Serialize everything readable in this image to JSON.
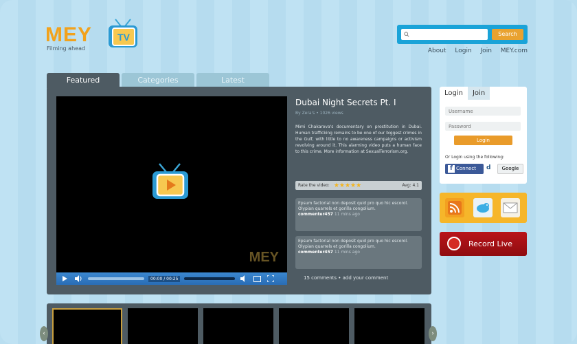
{
  "brand": {
    "name": "MEY",
    "tv": "TV",
    "tagline": "Filming ahead",
    "watermark": "MEY"
  },
  "search": {
    "placeholder": "",
    "button": "Search"
  },
  "top_links": [
    "About",
    "Login",
    "Join",
    "MEY.com"
  ],
  "tabs": [
    {
      "label": "Featured",
      "active": true
    },
    {
      "label": "Categories",
      "active": false
    },
    {
      "label": "Latest",
      "active": false
    }
  ],
  "player": {
    "time": "00:00 / 00:25"
  },
  "video": {
    "title": "Dubai Night Secrets Pt. I",
    "meta": "By Zera's • 1026 views",
    "description": "Mimi Chakarova's documentary on prostitution in Dubai. Human trafficking remains to be one of our biggest crimes in the Gulf, with little to no awareness campaigns or activism revolving around it. This alarming video puts a human face to this crime. More information at SexualTerrorism.org.",
    "rate_label": "Rate the video:",
    "rating_stars": 5,
    "avg_label": "Avg: 4.1"
  },
  "comments": [
    {
      "text": "Epsum factorial non deposit quid pro quo hic escorol. Olypian quarrels et gorilla congolium.",
      "user": "commenter457",
      "time": "11 mins ago"
    },
    {
      "text": "Epsum factorial non deposit quid pro quo hic escorol. Olypian quarrels et gorilla congolium.",
      "user": "commenter457",
      "time": "11 mins ago"
    }
  ],
  "comments_link": "15 comments  •  add your comment",
  "login": {
    "tab_login": "Login",
    "tab_join": "Join",
    "username_placeholder": "Username",
    "password_placeholder": "Password",
    "button": "Login",
    "or_text": "Or Login using the following:",
    "facebook": "Connect",
    "facebook_f": "f",
    "digg": "d",
    "google": "Google"
  },
  "record_live": "Record Live",
  "colors": {
    "accent": "#1aa3d8",
    "orange": "#e99b2a",
    "panel": "#4e5b63",
    "record": "#b9141a"
  }
}
